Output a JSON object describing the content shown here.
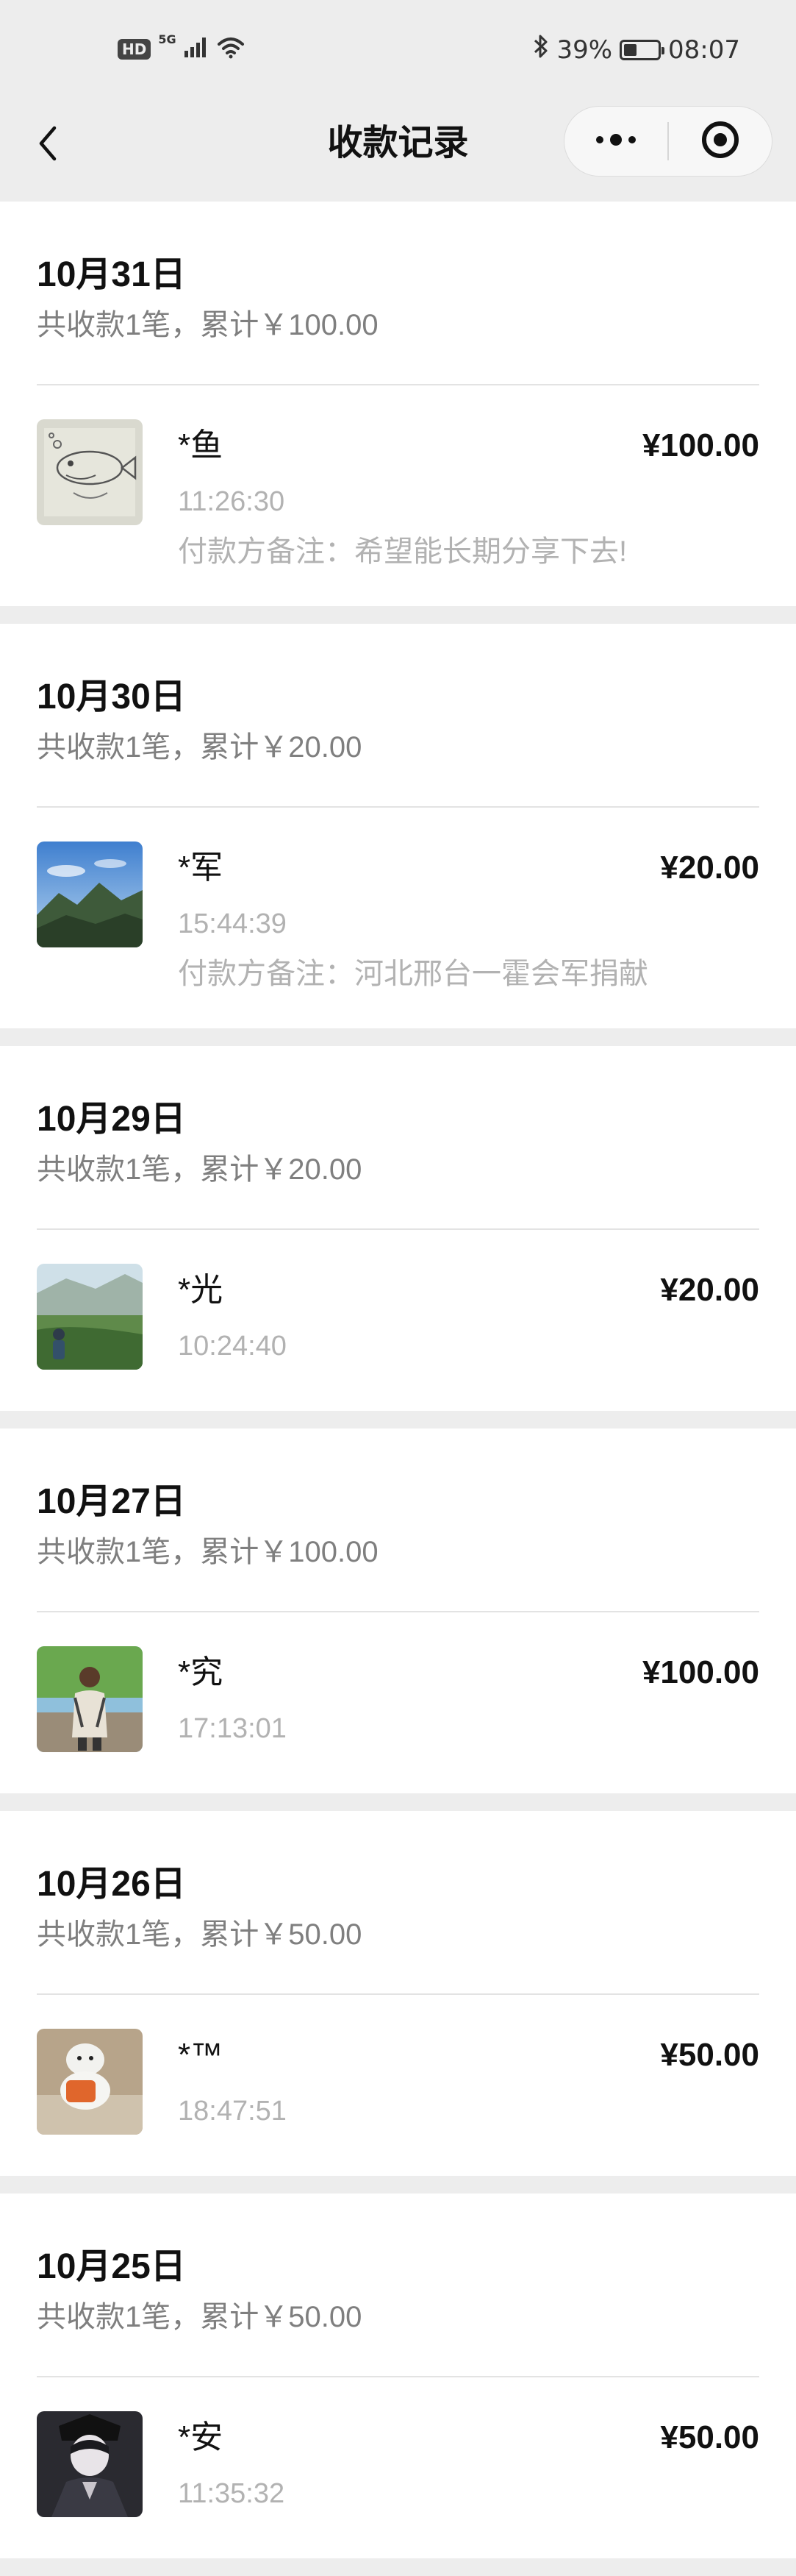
{
  "status_bar": {
    "hd": "HD",
    "network": "5G",
    "battery_text": "39%",
    "battery_level": 0.39,
    "time": "08:07"
  },
  "nav": {
    "title": "收款记录",
    "back_icon": "chevron-left-icon",
    "more_icon": "more-dots-icon",
    "close_icon": "target-icon"
  },
  "days": [
    {
      "date": "10月31日",
      "summary": "共收款1笔，累计￥100.00",
      "record": {
        "name": "*鱼",
        "amount": "¥100.00",
        "time": "11:26:30",
        "note": "付款方备注：希望能长期分享下去!"
      }
    },
    {
      "date": "10月30日",
      "summary": "共收款1笔，累计￥20.00",
      "record": {
        "name": "*军",
        "amount": "¥20.00",
        "time": "15:44:39",
        "note": "付款方备注：河北邢台一霍会军捐献"
      }
    },
    {
      "date": "10月29日",
      "summary": "共收款1笔，累计￥20.00",
      "record": {
        "name": "*光",
        "amount": "¥20.00",
        "time": "10:24:40",
        "note": ""
      }
    },
    {
      "date": "10月27日",
      "summary": "共收款1笔，累计￥100.00",
      "record": {
        "name": "*究",
        "amount": "¥100.00",
        "time": "17:13:01",
        "note": ""
      }
    },
    {
      "date": "10月26日",
      "summary": "共收款1笔，累计￥50.00",
      "record": {
        "name": "*™",
        "amount": "¥50.00",
        "time": "18:47:51",
        "note": ""
      }
    },
    {
      "date": "10月25日",
      "summary": "共收款1笔，累计￥50.00",
      "record": {
        "name": "*安",
        "amount": "¥50.00",
        "time": "11:35:32",
        "note": ""
      }
    }
  ]
}
